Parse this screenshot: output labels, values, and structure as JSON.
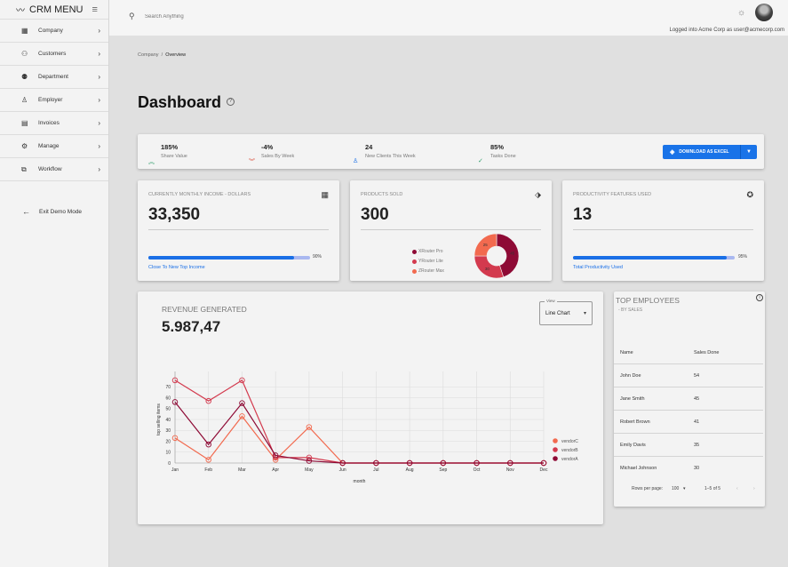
{
  "app": {
    "title": "CRM MENU"
  },
  "sidebar": {
    "items": [
      {
        "label": "Company",
        "icon": "building-icon"
      },
      {
        "label": "Customers",
        "icon": "person-add-icon"
      },
      {
        "label": "Department",
        "icon": "group-icon"
      },
      {
        "label": "Employer",
        "icon": "person-icon"
      },
      {
        "label": "Invoices",
        "icon": "invoice-icon"
      },
      {
        "label": "Manage",
        "icon": "gear-icon"
      },
      {
        "label": "Workflow",
        "icon": "workflow-icon"
      }
    ],
    "exit_label": "Exit Demo Mode"
  },
  "header": {
    "search_placeholder": "Search Anything",
    "logged_in_text": "Logged into Acme Corp as user@acmecorp.com"
  },
  "breadcrumb": {
    "parent": "Company",
    "separator": "/",
    "current": "Overview"
  },
  "page": {
    "title": "Dashboard"
  },
  "stats": [
    {
      "value": "185%",
      "label": "Share Value",
      "icon": "double-chevron-up-icon",
      "color": "#2e9d6b"
    },
    {
      "value": "-4%",
      "label": "Sales By Week",
      "icon": "double-chevron-down-icon",
      "color": "#d94d3a"
    },
    {
      "value": "24",
      "label": "New Clients This Week",
      "icon": "person-icon",
      "color": "#1a6fe6"
    },
    {
      "value": "85%",
      "label": "Tasks Done",
      "icon": "check-icon",
      "color": "#2e9d6b"
    }
  ],
  "download": {
    "label": "DOWNLOAD AS EXCEL",
    "color": "#1973e8"
  },
  "kpis": {
    "income": {
      "title": "CURRENTLY MONTHLY INCOME - DOLLARS",
      "value": "33,350",
      "progress_pct": 90,
      "progress_label": "90%",
      "link": "Close To New Top Income"
    },
    "products": {
      "title": "PRODUCTS SOLD",
      "value": "300"
    },
    "productivity": {
      "title": "PRODUCTIVITY FEATURES USED",
      "value": "13",
      "progress_pct": 95,
      "progress_label": "95%",
      "link": "Total Productivity Used"
    }
  },
  "revenue": {
    "title": "REVENUE GENERATED",
    "value": "5.987,47",
    "view_legend": "View",
    "view_value": "Line Chart"
  },
  "employees": {
    "title": "TOP EMPLOYEES",
    "subtitle": "- BY SALES",
    "columns": [
      "Name",
      "Sales Done"
    ],
    "rows": [
      [
        "John Doe",
        "54"
      ],
      [
        "Jane Smith",
        "45"
      ],
      [
        "Robert Brown",
        "41"
      ],
      [
        "Emily Davis",
        "35"
      ],
      [
        "Michael Johnson",
        "30"
      ]
    ],
    "rows_per_page_label": "Rows per page:",
    "rows_per_page": "100",
    "range": "1–5 of 5"
  },
  "chart_data": [
    {
      "type": "pie",
      "labels": [
        "XRouter Pro",
        "YRouter Lite",
        "ZRouter Max"
      ],
      "values": [
        45,
        30,
        25
      ],
      "slice_labels": [
        "45",
        "30",
        "25"
      ],
      "colors": [
        "#8e0a35",
        "#d33a4e",
        "#f26a4f"
      ],
      "donut": true
    },
    {
      "type": "line",
      "x": [
        "Jan",
        "Feb",
        "Mar",
        "Apr",
        "May",
        "Jun",
        "Jul",
        "Aug",
        "Sep",
        "Oct",
        "Nov",
        "Dec"
      ],
      "xlabel": "month",
      "ylabel": "top selling items",
      "ylim": [
        0,
        80
      ],
      "yticks": [
        0,
        10,
        20,
        30,
        40,
        50,
        60,
        70
      ],
      "grid": true,
      "legend": "right",
      "series": [
        {
          "name": "vendorC",
          "color": "#f26a4f",
          "values": [
            23,
            3,
            43,
            3,
            33,
            0,
            0,
            0,
            0,
            0,
            0,
            0
          ]
        },
        {
          "name": "vendorB",
          "color": "#d33a4e",
          "values": [
            76,
            57,
            76,
            5,
            5,
            0,
            0,
            0,
            0,
            0,
            0,
            0
          ]
        },
        {
          "name": "vendorA",
          "color": "#8e0a35",
          "values": [
            56,
            17,
            55,
            7,
            2,
            0,
            0,
            0,
            0,
            0,
            0,
            0
          ]
        }
      ]
    }
  ]
}
